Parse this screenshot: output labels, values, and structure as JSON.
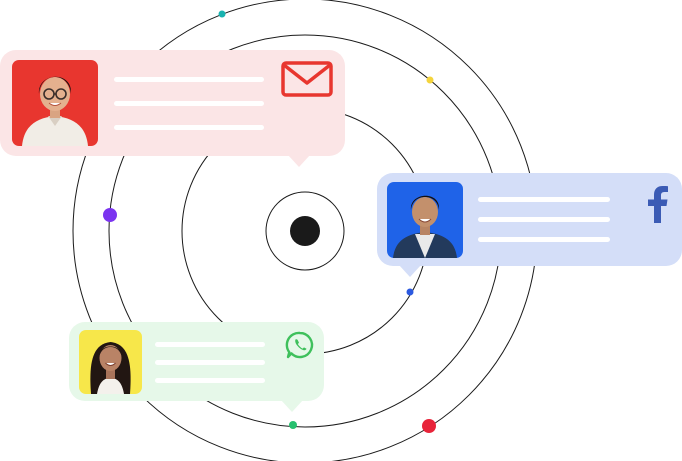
{
  "colors": {
    "orbit_stroke": "#1a1a1a",
    "center_dot": "#1a1a1a",
    "dot_teal": "#19b3b0",
    "dot_yellow": "#f4d43c",
    "dot_purple": "#7b34f0",
    "dot_blue": "#2b59e0",
    "dot_green": "#27c06f",
    "dot_red": "#e8243a",
    "email_card_bg": "#fbe5e6",
    "email_icon": "#e8362f",
    "facebook_card_bg": "#d4def8",
    "facebook_icon": "#3b5bb5",
    "whatsapp_card_bg": "#e6f8e9",
    "whatsapp_icon": "#3fc05c"
  },
  "cards": {
    "email": {
      "icon": "envelope-icon",
      "avatar": "woman-glasses-avatar"
    },
    "facebook": {
      "icon": "facebook-icon",
      "avatar": "man-smiling-avatar"
    },
    "whatsapp": {
      "icon": "whatsapp-icon",
      "avatar": "woman-long-hair-avatar"
    }
  }
}
